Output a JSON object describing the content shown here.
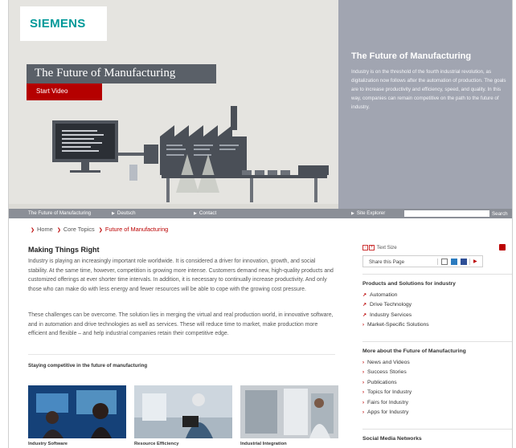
{
  "brand": {
    "logo": "SIEMENS",
    "accent_color": "#009999",
    "red": "#b50000"
  },
  "hero": {
    "title": "The Future of Manufacturing",
    "start_video_label": "Start Video",
    "side_title": "The Future of Manufacturing",
    "side_text": "Industry is on the threshold of the fourth industrial revolution, as digitalization now follows after the automation of production. The goals are to increase productivity and efficiency, speed, and quality. In this way, companies can remain competitive on the path to the future of industry."
  },
  "navbar": {
    "items": [
      "The Future of Manufacturing",
      "Deutsch",
      "Contact",
      "Site Explorer"
    ],
    "search_button": "Search"
  },
  "breadcrumb": {
    "items": [
      "Home",
      "Core Topics",
      "Future of Manufacturing"
    ]
  },
  "main": {
    "title": "Making Things Right",
    "paragraph1": "Industry is playing an increasingly important role worldwide. It is considered a driver for innovation, growth, and social stability. At the same time, however, competition is growing more intense. Customers demand new, high-quality products and customized offerings at ever shorter time intervals. In addition, it is necessary to continually increase productivity. And only those who can make do with less energy and fewer resources will be able to cope with the growing cost pressure.",
    "paragraph2": "These challenges can be overcome. The solution lies in merging the virtual and real production world, in innovative software, and in automation and drive technologies as well as services. These will reduce time to market, make production more efficient and flexible – and help industrial companies retain their competitive edge.",
    "section_title": "Staying competitive in the future of manufacturing",
    "thumbnails": [
      {
        "label": "Industry Software"
      },
      {
        "label": "Resource Efficiency"
      },
      {
        "label": "Industrial Integration"
      }
    ]
  },
  "sidebar": {
    "text_size_label": "Text Size",
    "text_size_minus": "-",
    "text_size_plus": "+",
    "share_label": "Share this Page",
    "products_heading": "Products and Solutions for industry",
    "products": [
      "Automation",
      "Drive Technology",
      "Industry Services",
      "Market-Specific Solutions"
    ],
    "more_heading": "More about the Future of Manufacturing",
    "more": [
      "News and Videos",
      "Success Stories",
      "Publications",
      "Topics for Industry",
      "Fairs for Industry",
      "Apps for Industry"
    ],
    "social_heading": "Social Media Networks"
  },
  "icons": [
    "search-icon",
    "email-icon",
    "twitter-icon",
    "facebook-icon",
    "more-share-icon",
    "print-icon",
    "external-link-icon",
    "chevron-right-icon"
  ]
}
